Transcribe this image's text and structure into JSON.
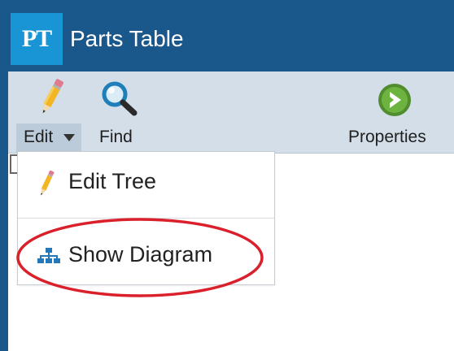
{
  "app": {
    "logo_text": "PT",
    "title": "Parts Table"
  },
  "toolbar": {
    "edit": {
      "label": "Edit",
      "icon": "pencil-icon"
    },
    "find": {
      "label": "Find",
      "icon": "magnifier-icon"
    },
    "properties": {
      "label": "Properties",
      "icon": "arrow-circle-icon"
    }
  },
  "edit_menu": {
    "items": [
      {
        "label": "Edit Tree",
        "icon": "pencil-icon"
      },
      {
        "label": "Show Diagram",
        "icon": "hierarchy-icon"
      }
    ]
  },
  "colors": {
    "title_bar": "#1a578a",
    "logo_bg": "#1995d6",
    "toolbar_bg": "#d3dee8",
    "annotation": "#d9202b"
  }
}
